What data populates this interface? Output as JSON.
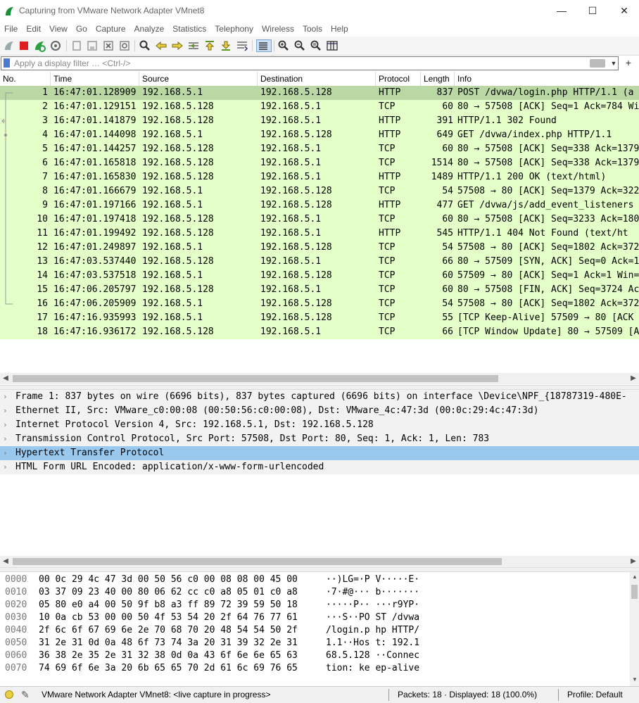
{
  "window": {
    "title": "Capturing from VMware Network Adapter VMnet8",
    "minimize": "—",
    "maximize": "☐",
    "close": "✕"
  },
  "menu": [
    "File",
    "Edit",
    "View",
    "Go",
    "Capture",
    "Analyze",
    "Statistics",
    "Telephony",
    "Wireless",
    "Tools",
    "Help"
  ],
  "filter": {
    "placeholder": "Apply a display filter … <Ctrl-/>",
    "expression_button": "+"
  },
  "columns": [
    "No.",
    "Time",
    "Source",
    "Destination",
    "Protocol",
    "Length",
    "Info"
  ],
  "packets": [
    {
      "no": "1",
      "time": "16:47:01.128909",
      "src": "192.168.5.1",
      "dst": "192.168.5.128",
      "proto": "HTTP",
      "len": "837",
      "info": "POST /dvwa/login.php HTTP/1.1  (a"
    },
    {
      "no": "2",
      "time": "16:47:01.129151",
      "src": "192.168.5.128",
      "dst": "192.168.5.1",
      "proto": "TCP",
      "len": "60",
      "info": "80 → 57508 [ACK] Seq=1 Ack=784 Wi"
    },
    {
      "no": "3",
      "time": "16:47:01.141879",
      "src": "192.168.5.128",
      "dst": "192.168.5.1",
      "proto": "HTTP",
      "len": "391",
      "info": "HTTP/1.1 302 Found"
    },
    {
      "no": "4",
      "time": "16:47:01.144098",
      "src": "192.168.5.1",
      "dst": "192.168.5.128",
      "proto": "HTTP",
      "len": "649",
      "info": "GET /dvwa/index.php HTTP/1.1"
    },
    {
      "no": "5",
      "time": "16:47:01.144257",
      "src": "192.168.5.128",
      "dst": "192.168.5.1",
      "proto": "TCP",
      "len": "60",
      "info": "80 → 57508 [ACK] Seq=338 Ack=1379"
    },
    {
      "no": "6",
      "time": "16:47:01.165818",
      "src": "192.168.5.128",
      "dst": "192.168.5.1",
      "proto": "TCP",
      "len": "1514",
      "info": "80 → 57508 [ACK] Seq=338 Ack=1379"
    },
    {
      "no": "7",
      "time": "16:47:01.165830",
      "src": "192.168.5.128",
      "dst": "192.168.5.1",
      "proto": "HTTP",
      "len": "1489",
      "info": "HTTP/1.1 200 OK  (text/html)"
    },
    {
      "no": "8",
      "time": "16:47:01.166679",
      "src": "192.168.5.1",
      "dst": "192.168.5.128",
      "proto": "TCP",
      "len": "54",
      "info": "57508 → 80 [ACK] Seq=1379 Ack=322"
    },
    {
      "no": "9",
      "time": "16:47:01.197166",
      "src": "192.168.5.1",
      "dst": "192.168.5.128",
      "proto": "HTTP",
      "len": "477",
      "info": "GET /dvwa/js/add_event_listeners"
    },
    {
      "no": "10",
      "time": "16:47:01.197418",
      "src": "192.168.5.128",
      "dst": "192.168.5.1",
      "proto": "TCP",
      "len": "60",
      "info": "80 → 57508 [ACK] Seq=3233 Ack=180"
    },
    {
      "no": "11",
      "time": "16:47:01.199492",
      "src": "192.168.5.128",
      "dst": "192.168.5.1",
      "proto": "HTTP",
      "len": "545",
      "info": "HTTP/1.1 404 Not Found  (text/ht"
    },
    {
      "no": "12",
      "time": "16:47:01.249897",
      "src": "192.168.5.1",
      "dst": "192.168.5.128",
      "proto": "TCP",
      "len": "54",
      "info": "57508 → 80 [ACK] Seq=1802 Ack=372"
    },
    {
      "no": "13",
      "time": "16:47:03.537440",
      "src": "192.168.5.128",
      "dst": "192.168.5.1",
      "proto": "TCP",
      "len": "66",
      "info": "80 → 57509 [SYN, ACK] Seq=0 Ack=1"
    },
    {
      "no": "14",
      "time": "16:47:03.537518",
      "src": "192.168.5.1",
      "dst": "192.168.5.128",
      "proto": "TCP",
      "len": "60",
      "info": "57509 → 80 [ACK] Seq=1 Ack=1 Win="
    },
    {
      "no": "15",
      "time": "16:47:06.205797",
      "src": "192.168.5.128",
      "dst": "192.168.5.1",
      "proto": "TCP",
      "len": "60",
      "info": "80 → 57508 [FIN, ACK] Seq=3724 Ac"
    },
    {
      "no": "16",
      "time": "16:47:06.205909",
      "src": "192.168.5.1",
      "dst": "192.168.5.128",
      "proto": "TCP",
      "len": "54",
      "info": "57508 → 80 [ACK] Seq=1802 Ack=372"
    },
    {
      "no": "17",
      "time": "16:47:16.935993",
      "src": "192.168.5.1",
      "dst": "192.168.5.128",
      "proto": "TCP",
      "len": "55",
      "info": "[TCP Keep-Alive] 57509 → 80 [ACK"
    },
    {
      "no": "18",
      "time": "16:47:16.936172",
      "src": "192.168.5.128",
      "dst": "192.168.5.1",
      "proto": "TCP",
      "len": "66",
      "info": "[TCP Window Update] 80 → 57509 [A"
    }
  ],
  "selected_packet": 0,
  "details": [
    {
      "expander": "›",
      "text": "Frame 1: 837 bytes on wire (6696 bits), 837 bytes captured (6696 bits) on interface \\Device\\NPF_{18787319-480E-"
    },
    {
      "expander": "›",
      "text": "Ethernet II, Src: VMware_c0:00:08 (00:50:56:c0:00:08), Dst: VMware_4c:47:3d (00:0c:29:4c:47:3d)"
    },
    {
      "expander": "›",
      "text": "Internet Protocol Version 4, Src: 192.168.5.1, Dst: 192.168.5.128"
    },
    {
      "expander": "›",
      "text": "Transmission Control Protocol, Src Port: 57508, Dst Port: 80, Seq: 1, Ack: 1, Len: 783"
    },
    {
      "expander": "›",
      "text": "Hypertext Transfer Protocol"
    },
    {
      "expander": "›",
      "text": "HTML Form URL Encoded: application/x-www-form-urlencoded"
    }
  ],
  "selected_detail": 4,
  "bytes": [
    {
      "offset": "0000",
      "hex": "00 0c 29 4c 47 3d 00 50  56 c0 00 08 08 00 45 00",
      "ascii": "··)LG=·P V·····E·"
    },
    {
      "offset": "0010",
      "hex": "03 37 09 23 40 00 80 06  62 cc c0 a8 05 01 c0 a8",
      "ascii": "·7·#@··· b·······"
    },
    {
      "offset": "0020",
      "hex": "05 80 e0 a4 00 50 9f b8  a3 ff 89 72 39 59 50 18",
      "ascii": "·····P·· ···r9YP·"
    },
    {
      "offset": "0030",
      "hex": "10 0a cb 53 00 00 50 4f  53 54 20 2f 64 76 77 61",
      "ascii": "···S··PO ST /dvwa"
    },
    {
      "offset": "0040",
      "hex": "2f 6c 6f 67 69 6e 2e 70  68 70 20 48 54 54 50 2f",
      "ascii": "/login.p hp HTTP/"
    },
    {
      "offset": "0050",
      "hex": "31 2e 31 0d 0a 48 6f 73  74 3a 20 31 39 32 2e 31",
      "ascii": "1.1··Hos t: 192.1"
    },
    {
      "offset": "0060",
      "hex": "36 38 2e 35 2e 31 32 38  0d 0a 43 6f 6e 6e 65 63",
      "ascii": "68.5.128 ··Connec"
    },
    {
      "offset": "0070",
      "hex": "74 69 6f 6e 3a 20 6b 65  65 70 2d 61 6c 69 76 65",
      "ascii": "tion: ke ep-alive"
    }
  ],
  "status": {
    "interface": "VMware Network Adapter VMnet8: <live capture in progress>",
    "packets": "Packets: 18 · Displayed: 18 (100.0%)",
    "profile": "Profile: Default"
  },
  "colors": {
    "http_row": "#e4ffc7",
    "selected_row": "#b9d8a4",
    "selected_detail": "#99c9ef",
    "detail_row": "#f2f2f2"
  }
}
